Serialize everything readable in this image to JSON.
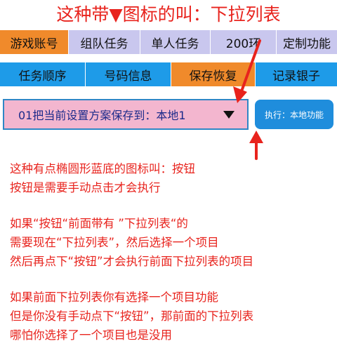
{
  "title": "这种带▼图标的叫：下拉列表",
  "tabs_row1": [
    {
      "label": "游戏账号",
      "active": true
    },
    {
      "label": "组队任务",
      "active": false
    },
    {
      "label": "单人任务",
      "active": false
    },
    {
      "label": "200环",
      "active": false
    },
    {
      "label": "定制功能",
      "active": false
    }
  ],
  "tabs_row2": [
    {
      "label": "任务顺序",
      "active": false
    },
    {
      "label": "号码信息",
      "active": false
    },
    {
      "label": "保存恢复",
      "active": true
    },
    {
      "label": "记录银子",
      "active": false
    }
  ],
  "dropdown": {
    "value": "01把当前设置方案保存到：本地1"
  },
  "button": {
    "label": "执行：本地功能"
  },
  "explain1": [
    "这种有点椭圆形蓝底的图标叫：按钮",
    "按钮是需要手动点击才会执行"
  ],
  "explain2": [
    "如果“按钮“前面带有 ”下拉列表“的",
    "需要现在“下拉列表”，然后选择一个项目",
    "然后再点下“按钮”才会执行前面下拉列表的项目"
  ],
  "explain3": [
    "如果前面下拉列表你有选择一个项目功能",
    "但是你没有手动点下“按钮”，那前面的下拉列表",
    "哪怕你选择了一个项目也是没用"
  ],
  "colors": {
    "red_text": "#e8231d",
    "tab_lilac": "#c9c7ee",
    "tab_blue": "#1e9be8",
    "tab_active": "#f08a2b",
    "button_blue": "#1f8ddc",
    "dropdown_pink": "#f3b6cf"
  }
}
